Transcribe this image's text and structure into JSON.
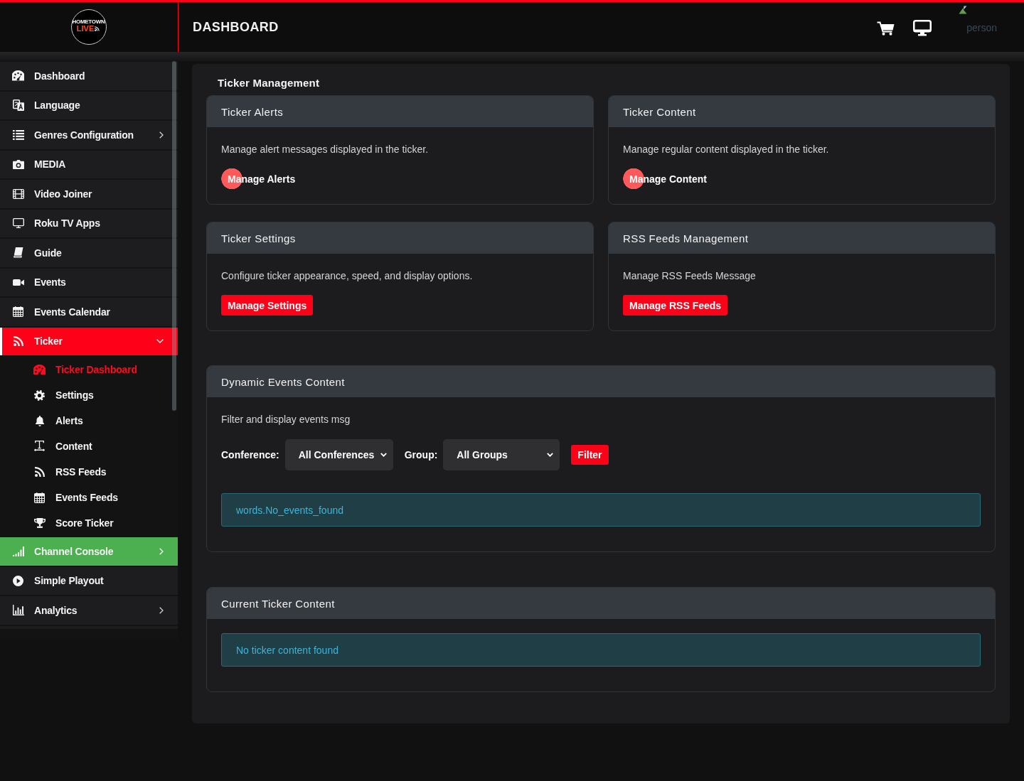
{
  "header": {
    "logo": {
      "line_1": "HOMETOWN",
      "line_2": "LIVE"
    },
    "title": "DASHBOARD",
    "user_label": "person"
  },
  "sidebar": {
    "items": [
      {
        "label": "Dashboard",
        "kind": "link",
        "selected": false,
        "highlighted": false
      },
      {
        "label": "Language",
        "kind": "link",
        "selected": false,
        "highlighted": false
      },
      {
        "label": "Genres Configuration",
        "kind": "group",
        "expanded": false,
        "selected": false,
        "highlighted": false
      },
      {
        "label": "MEDIA",
        "kind": "link",
        "selected": false,
        "highlighted": false
      },
      {
        "label": "Video Joiner",
        "kind": "link",
        "selected": false,
        "highlighted": false
      },
      {
        "label": "Roku TV Apps",
        "kind": "link",
        "selected": false,
        "highlighted": false
      },
      {
        "label": "Guide",
        "kind": "link",
        "selected": false,
        "highlighted": false
      },
      {
        "label": "Events",
        "kind": "link",
        "selected": false,
        "highlighted": false
      },
      {
        "label": "Events Calendar",
        "kind": "link",
        "selected": false,
        "highlighted": false
      },
      {
        "label": "Ticker",
        "kind": "group",
        "expanded": true,
        "selected": true,
        "highlighted": false,
        "children": [
          {
            "label": "Ticker Dashboard",
            "selected": true
          },
          {
            "label": "Settings",
            "selected": false
          },
          {
            "label": "Alerts",
            "selected": false
          },
          {
            "label": "Content",
            "selected": false
          },
          {
            "label": "RSS Feeds",
            "selected": false
          },
          {
            "label": "Events Feeds",
            "selected": false
          },
          {
            "label": "Score Ticker",
            "selected": false
          }
        ]
      },
      {
        "label": "Channel Console",
        "kind": "group",
        "expanded": false,
        "selected": false,
        "highlighted": true
      },
      {
        "label": "Simple Playout",
        "kind": "link",
        "selected": false,
        "highlighted": false
      },
      {
        "label": "Analytics",
        "kind": "group",
        "expanded": false,
        "selected": false,
        "highlighted": false
      }
    ]
  },
  "main": {
    "section_title": "Ticker Management",
    "cards": [
      {
        "title": "Ticker Alerts",
        "description": "Manage alert messages displayed in the ticker.",
        "button": {
          "label": "Manage Alerts",
          "kind": "ripple"
        }
      },
      {
        "title": "Ticker Content",
        "description": "Manage regular content displayed in the ticker.",
        "button": {
          "label": "Manage Content",
          "kind": "ripple"
        }
      },
      {
        "title": "Ticker Settings",
        "description": "Configure ticker appearance, speed, and display options.",
        "button": {
          "label": "Manage Settings",
          "kind": "solid"
        }
      },
      {
        "title": "RSS Feeds Management",
        "description": "Manage RSS Feeds Message",
        "button": {
          "label": "Manage RSS Feeds",
          "kind": "solid"
        }
      }
    ],
    "events_card": {
      "title": "Dynamic Events Content",
      "description": "Filter and display events msg",
      "filters": [
        {
          "label": "Conference:",
          "value": "All Conferences"
        },
        {
          "label": "Group:",
          "value": "All Groups"
        }
      ],
      "filter_button": "Filter",
      "message": "words.No_events_found"
    },
    "current_content_card": {
      "title": "Current Ticker Content",
      "message": "No ticker content found"
    }
  }
}
